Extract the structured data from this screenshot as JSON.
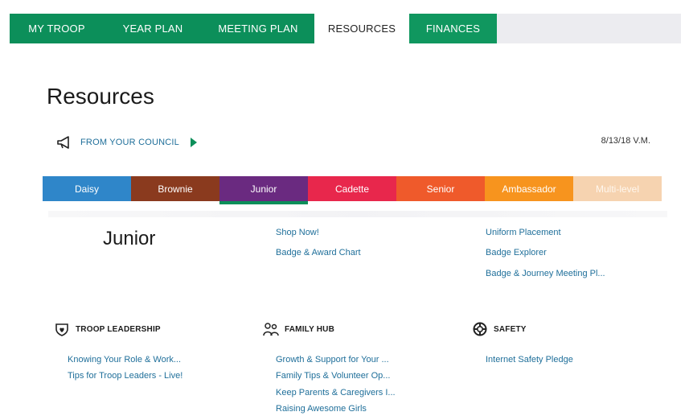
{
  "nav": {
    "tabs": [
      {
        "label": "MY TROOP"
      },
      {
        "label": "YEAR PLAN"
      },
      {
        "label": "MEETING PLAN"
      },
      {
        "label": "RESOURCES"
      },
      {
        "label": "FINANCES"
      }
    ],
    "active": "RESOURCES"
  },
  "page": {
    "title": "Resources",
    "council_label": "FROM YOUR COUNCIL",
    "date": "8/13/18 V.M."
  },
  "levels": [
    {
      "label": "Daisy",
      "color": "#2f86c9"
    },
    {
      "label": "Brownie",
      "color": "#8a3a1e"
    },
    {
      "label": "Junior",
      "color": "#6a2a80"
    },
    {
      "label": "Cadette",
      "color": "#e8274c"
    },
    {
      "label": "Senior",
      "color": "#ef5a2b"
    },
    {
      "label": "Ambassador",
      "color": "#f7941e"
    },
    {
      "label": "Multi-level",
      "color": "#f6d3b0"
    }
  ],
  "selected_level": {
    "heading": "Junior",
    "links_col1": [
      "Shop Now!",
      "Badge & Award Chart"
    ],
    "links_col2": [
      "Uniform Placement",
      "Badge Explorer",
      "Badge & Journey Meeting Pl..."
    ]
  },
  "sections": {
    "troop_leadership": {
      "title": "TROOP LEADERSHIP",
      "links": [
        "Knowing Your Role & Work...",
        "Tips for Troop Leaders - Live!"
      ]
    },
    "family_hub": {
      "title": "FAMILY HUB",
      "links": [
        "Growth & Support for Your ...",
        "Family Tips & Volunteer Op...",
        "Keep Parents & Caregivers I...",
        "Raising Awesome Girls"
      ]
    },
    "safety": {
      "title": "SAFETY",
      "links": [
        "Internet Safety Pledge"
      ]
    }
  },
  "colors": {
    "brand_green": "#0c8f5a",
    "link_blue": "#1f6f9a"
  }
}
